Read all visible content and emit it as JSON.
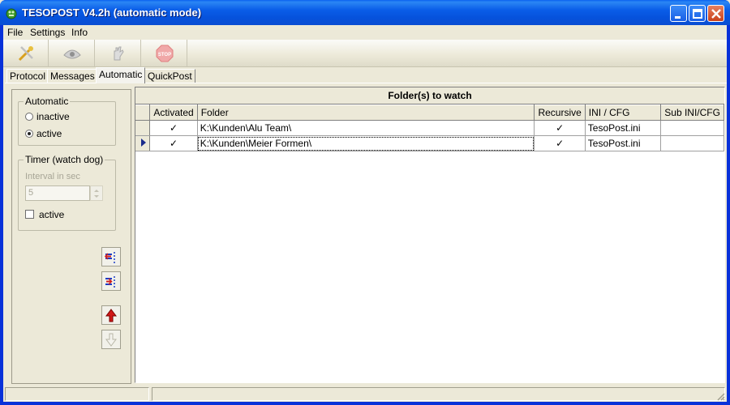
{
  "window": {
    "title": "TESOPOST V4.2h (automatic mode)",
    "accent_color": "#0a5de8",
    "controls": [
      "minimize-icon",
      "maximize-icon",
      "close-icon"
    ]
  },
  "menu": {
    "items": [
      "File",
      "Settings",
      "Info"
    ]
  },
  "toolbar": {
    "buttons": [
      {
        "icon": "tools-icon",
        "enabled": true
      },
      {
        "icon": "eye-icon",
        "enabled": false
      },
      {
        "icon": "hand-icon",
        "enabled": false
      },
      {
        "icon": "stop-icon",
        "label": "STOP",
        "enabled": false
      }
    ]
  },
  "tabs": [
    "Protocol",
    "Messages",
    "Automatic",
    "QuickPost"
  ],
  "active_tab": "Automatic",
  "automatic": {
    "group_title": "Automatic",
    "options": [
      "inactive",
      "active"
    ],
    "selected": "active"
  },
  "timer": {
    "group_title": "Timer (watch dog)",
    "interval_label": "Interval in sec",
    "interval_value": "5",
    "active_label": "active",
    "active_checked": false
  },
  "side_buttons": [
    "list-remove-icon",
    "list-add-icon",
    "arrow-up-icon",
    "arrow-down-icon"
  ],
  "grid": {
    "title": "Folder(s) to watch",
    "columns": [
      "Activated",
      "Folder",
      "Recursive",
      "INI / CFG",
      "Sub INI/CFG"
    ],
    "rows": [
      {
        "activated": "✓",
        "folder": "K:\\Kunden\\Alu Team\\",
        "recursive": "✓",
        "ini": "TesoPost.ini",
        "sub_ini": ""
      },
      {
        "activated": "✓",
        "folder": "K:\\Kunden\\Meier Formen\\",
        "recursive": "✓",
        "ini": "TesoPost.ini",
        "sub_ini": ""
      }
    ],
    "current_row": 2
  }
}
